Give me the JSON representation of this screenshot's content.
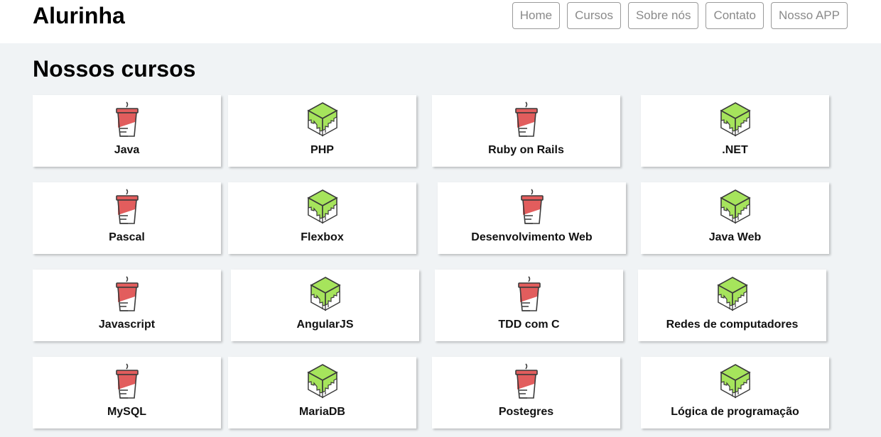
{
  "app": {
    "logo": "Alurinha"
  },
  "nav": {
    "items": [
      {
        "label": "Home",
        "name": "nav-home-button"
      },
      {
        "label": "Cursos",
        "name": "nav-cursos-button"
      },
      {
        "label": "Sobre nós",
        "name": "nav-sobre-nos-button"
      },
      {
        "label": "Contato",
        "name": "nav-contato-button"
      },
      {
        "label": "Nosso APP",
        "name": "nav-nosso-app-button"
      }
    ]
  },
  "main": {
    "title": "Nossos cursos",
    "courses": [
      {
        "label": "Java",
        "icon": "cup-icon"
      },
      {
        "label": "PHP",
        "icon": "cube-icon"
      },
      {
        "label": "Ruby on Rails",
        "icon": "cup-icon"
      },
      {
        "label": ".NET",
        "icon": "cube-icon"
      },
      {
        "label": "Pascal",
        "icon": "cup-icon"
      },
      {
        "label": "Flexbox",
        "icon": "cube-icon"
      },
      {
        "label": "Desenvolvimento Web",
        "icon": "cup-icon"
      },
      {
        "label": "Java Web",
        "icon": "cube-icon"
      },
      {
        "label": "Javascript",
        "icon": "cup-icon"
      },
      {
        "label": "AngularJS",
        "icon": "cube-icon"
      },
      {
        "label": "TDD com C",
        "icon": "cup-icon"
      },
      {
        "label": "Redes de computadores",
        "icon": "cube-icon"
      },
      {
        "label": "MySQL",
        "icon": "cup-icon"
      },
      {
        "label": "MariaDB",
        "icon": "cube-icon"
      },
      {
        "label": "Postegres",
        "icon": "cup-icon"
      },
      {
        "label": "Lógica de programação",
        "icon": "cube-icon"
      }
    ]
  },
  "colors": {
    "cup_red": "#e25d5d",
    "cube_green": "#a6e45c",
    "outline": "#3a3a3a",
    "background": "#f0f3f5"
  }
}
